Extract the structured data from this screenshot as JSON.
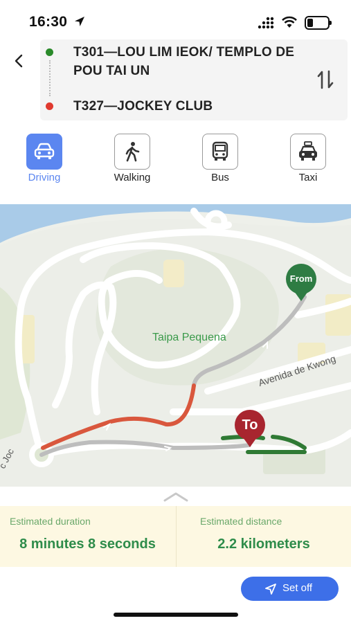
{
  "status_bar": {
    "time": "16:30"
  },
  "route": {
    "from": "T301—LOU LIM IEOK/ TEMPLO DE POU TAI UN",
    "to": "T327—JOCKEY CLUB"
  },
  "modes": [
    {
      "label": "Driving",
      "icon": "car-icon",
      "active": true
    },
    {
      "label": "Walking",
      "icon": "walking-person-icon",
      "active": false
    },
    {
      "label": "Bus",
      "icon": "bus-icon",
      "active": false
    },
    {
      "label": "Taxi",
      "icon": "taxi-icon",
      "active": false
    }
  ],
  "map": {
    "place_label": "Taipa Pequena",
    "street_label": "Avenida de Kwong",
    "street_label_2": "c Joc",
    "from_pin": "From",
    "to_pin": "To"
  },
  "summary": {
    "duration_caption": "Estimated duration",
    "duration_value": "8 minutes 8 seconds",
    "distance_caption": "Estimated distance",
    "distance_value": "2.2 kilometers"
  },
  "actions": {
    "set_off": "Set off"
  },
  "colors": {
    "accent": "#3d6fe8",
    "active_mode": "#5b86f0",
    "from_dot": "#2a8a2a",
    "to_dot": "#e03a2f",
    "route_congested": "#d9573d",
    "route_clear": "#2f7a34",
    "summary_text": "#2e8c4a"
  }
}
